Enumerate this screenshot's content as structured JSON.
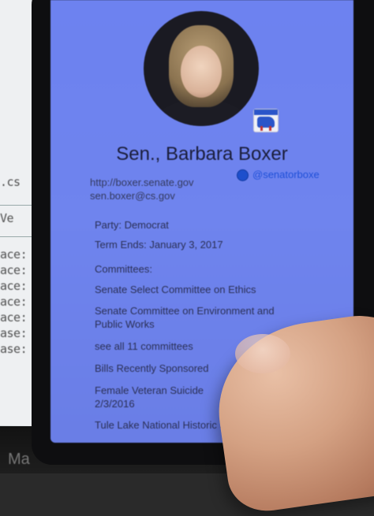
{
  "background": {
    "monitor_text_rows": [
      ".cs",
      "Ve",
      "ace:",
      "ace:",
      "ace:",
      "ace:",
      "ace:",
      "ase:",
      "ase:"
    ],
    "bottom_label": "Ma"
  },
  "profile": {
    "name": "Sen., Barbara Boxer",
    "website": "http://boxer.senate.gov",
    "twitter_handle": "@senatorboxe",
    "email": "sen.boxer@cs.gov",
    "party": "Party: Democrat",
    "term_ends": "Term Ends: January 3, 2017",
    "committees_heading": "Committees:",
    "committees": [
      "Senate Select Committee on Ethics",
      "Senate Committee on Environment and Public Works"
    ],
    "see_all_link": "see all 11 committees",
    "bills_heading": "Bills Recently Sponsored",
    "bills": [
      "Female Veteran Suicide",
      "2/3/2016",
      "Tule Lake National Historic Site"
    ],
    "party_icon": "democrat-donkey-icon",
    "twitter_icon": "twitter-icon"
  },
  "colors": {
    "screen": "#6d82f0",
    "link": "#1e4fd8",
    "donkey": "#2a55c9"
  }
}
